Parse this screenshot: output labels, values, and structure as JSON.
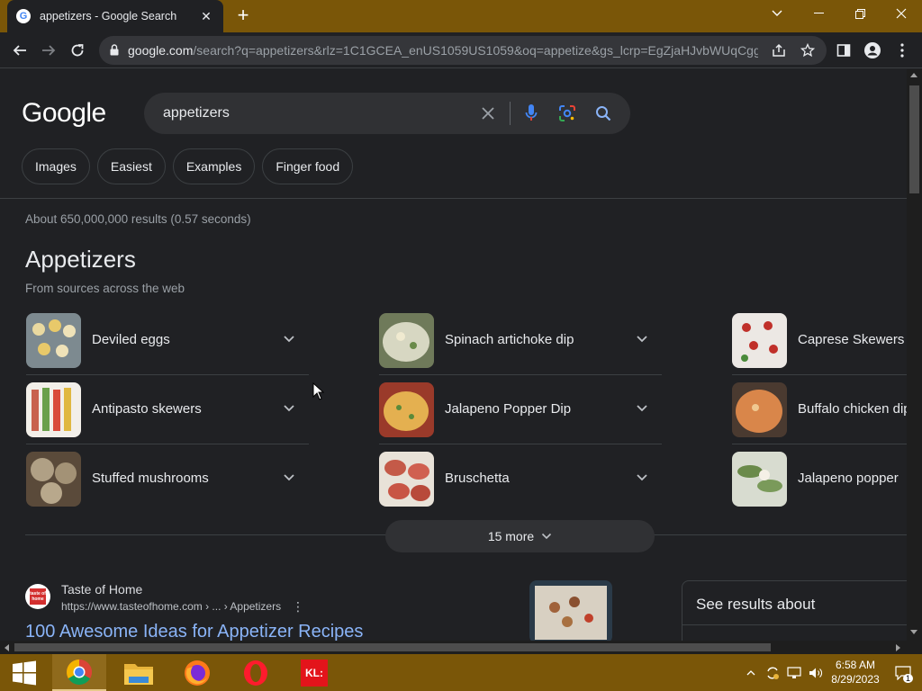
{
  "browser": {
    "tab_title": "appetizers - Google Search",
    "url_host": "google.com",
    "url_rest": "/search?q=appetizers&rlz=1C1GCEA_enUS1059US1059&oq=appetize&gs_lcrp=EgZjaHJvbWUqCgg..."
  },
  "search": {
    "logo": "Google",
    "query": "appetizers"
  },
  "chips": [
    "Images",
    "Easiest",
    "Examples",
    "Finger food"
  ],
  "results_stats": "About 650,000,000 results (0.57 seconds)",
  "section": {
    "title": "Appetizers",
    "subtitle": "From sources across the web",
    "items": [
      {
        "label": "Deviled eggs",
        "color": "#c9b27a"
      },
      {
        "label": "Spinach artichoke dip",
        "color": "#b7c1a2"
      },
      {
        "label": "Caprese Skewers",
        "color": "#d8cfc8"
      },
      {
        "label": "Antipasto skewers",
        "color": "#c8624e"
      },
      {
        "label": "Jalapeno Popper Dip",
        "color": "#d9a25a"
      },
      {
        "label": "Buffalo chicken dip",
        "color": "#d9864a"
      },
      {
        "label": "Stuffed mushrooms",
        "color": "#8c7a64"
      },
      {
        "label": "Bruschetta",
        "color": "#c45a48"
      },
      {
        "label": "Jalapeno popper",
        "color": "#8a9a6a"
      }
    ],
    "more_label": "15 more"
  },
  "result": {
    "site": "Taste of Home",
    "favicon_text": "taste of home",
    "url": "https://www.tasteofhome.com › ... › Appetizers",
    "title": "100 Awesome Ideas for Appetizer Recipes",
    "thumb_color": "#6a6258"
  },
  "side_panel": {
    "title": "See results about"
  },
  "taskbar": {
    "time": "6:58 AM",
    "date": "8/29/2023",
    "notification_count": "1",
    "apps": [
      "windows-start",
      "chrome",
      "file-explorer",
      "firefox",
      "opera",
      "kl-app"
    ],
    "kl_label": "KL:"
  },
  "colors": {
    "accent_link": "#8ab4f8",
    "titlebar": "#7a5608",
    "background": "#202124"
  }
}
